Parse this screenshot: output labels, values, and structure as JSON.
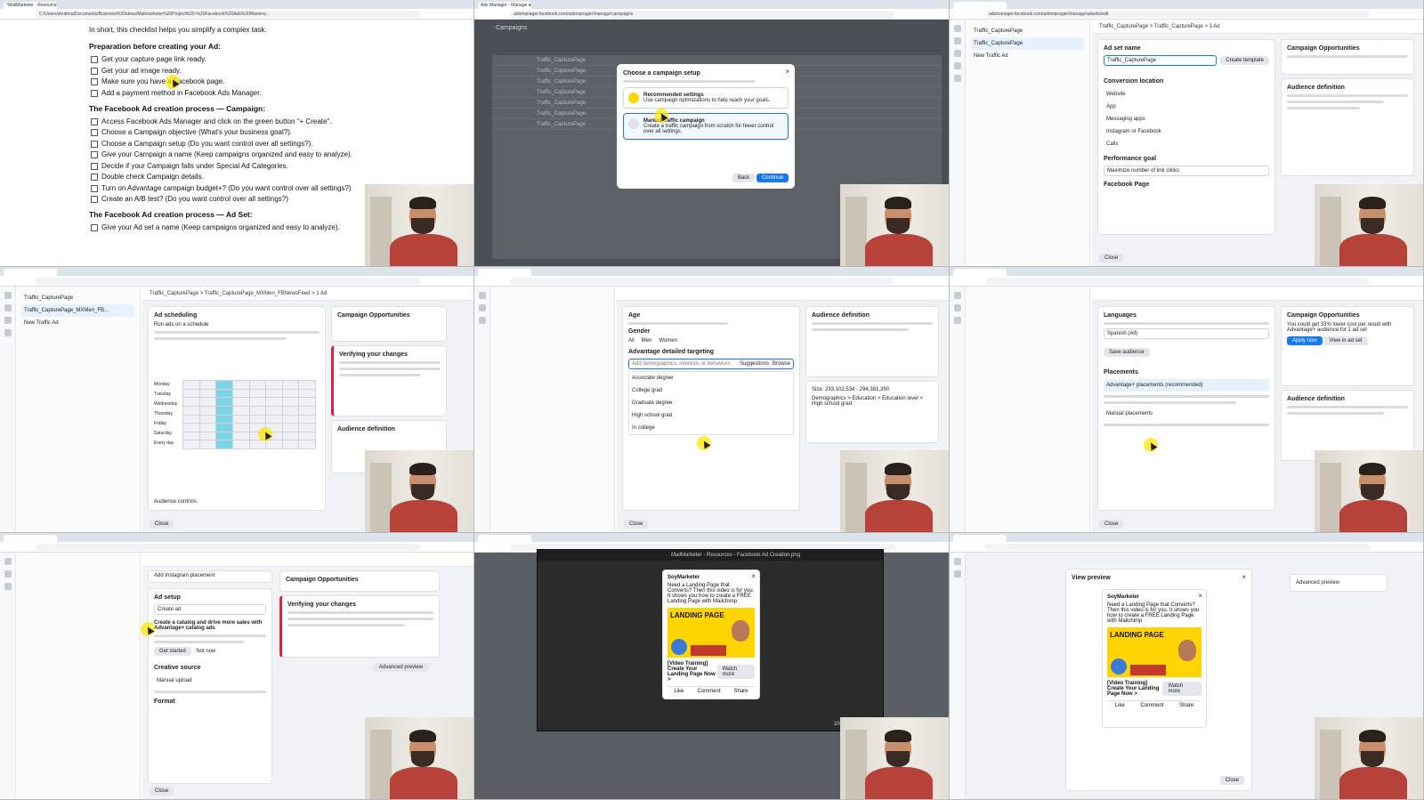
{
  "tile1": {
    "tab": "*MailMarketer - Resources - How To C...",
    "url": "C:/Users/skrahna/Documents/Business%20ideas/Mailmarketer%20Project%20-%20Facebook%20Ads%20Mastery...",
    "intro": "In short, this checklist helps you simplify a complex task.",
    "h1": "Preparation before creating your Ad:",
    "prep": [
      "Get your capture page link ready.",
      "Get your ad image ready.",
      "Make sure you have a Facebook page.",
      "Add a payment method in Facebook Ads Manager."
    ],
    "h2": "The Facebook Ad creation process — Campaign:",
    "campaign": [
      "Access Facebook Ads Manager and click on the green button \"+ Create\".",
      "Choose a Campaign objective (What's your business goal?).",
      "Choose a Campaign setup (Do you want control over all settings?).",
      "Give your Campaign a name (Keep campaigns organized and easy to analyze).",
      "Decide if your Campaign falls under Special Ad Categories.",
      "Double check Campaign details.",
      "Turn on Advantage campaign budget+? (Do you want control over all settings?)",
      "Create an A/B test? (Do you want control over all settings?)"
    ],
    "h3": "The Facebook Ad creation process — Ad Set:",
    "adset": [
      "Give your Ad set a name (Keep campaigns organized and easy to analyze)."
    ]
  },
  "tile2": {
    "tab": "Ads Manager - Manage ads",
    "url": "adsmanager.facebook.com/adsmanager/manage/campaigns",
    "page_title": "Campaigns",
    "rows": [
      "Traffic_CapturePage",
      "Traffic_CapturePage",
      "Traffic_CapturePage",
      "Traffic_CapturePage",
      "Traffic_CapturePage",
      "Traffic_CapturePage",
      "Traffic_CapturePage"
    ],
    "modal_title": "Choose a campaign setup",
    "opt1_title": "Recommended settings",
    "opt1_desc": "Use campaign optimizations to help reach your goals.",
    "opt2_title": "Manual traffic campaign",
    "opt2_desc": "Create a traffic campaign from scratch for fewer control over all settings.",
    "back": "Back",
    "continue": "Continue"
  },
  "tile3": {
    "url": "adsmanager.facebook.com/adsmanager/manage/adsets/edit",
    "breadcrumb": "Traffic_CapturePage  >  Traffic_CapturePage  >  1 Ad",
    "side": [
      "Traffic_CapturePage",
      "Traffic_CapturePage",
      "New Traffic Ad"
    ],
    "adset_name_label": "Ad set name",
    "adset_name_value": "Traffic_CapturePage",
    "create_template": "Create template",
    "conversion_label": "Conversion location",
    "conv_opts": [
      "Website",
      "App",
      "Messaging apps",
      "Instagram or Facebook",
      "Calls"
    ],
    "perf_goal": "Performance goal",
    "perf_value": "Maximize number of link clicks",
    "fb_page": "Facebook Page",
    "opps": "Campaign Opportunities",
    "aud_def": "Audience definition",
    "close": "Close"
  },
  "tile4": {
    "breadcrumb": "Traffic_CapturePage  >  Traffic_CapturePage_MXMen_FBNewsFeed  >  1 Ad",
    "side": [
      "Traffic_CapturePage",
      "Traffic_CapturePage_MXMen_FB...",
      "New Traffic Ad"
    ],
    "sched_title": "Ad scheduling",
    "sched_opt": "Run ads on a schedule",
    "days": [
      "Monday",
      "Tuesday",
      "Wednesday",
      "Thursday",
      "Friday",
      "Saturday",
      "Every day"
    ],
    "verify": "Verifying your changes",
    "opps": "Campaign Opportunities",
    "aud_def": "Audience definition",
    "aud_ctrl": "Audience controls",
    "close": "Close"
  },
  "tile5": {
    "age": "Age",
    "gender": "Gender",
    "gender_opts": [
      "All",
      "Men",
      "Women"
    ],
    "detailed": "Advantage detailed targeting",
    "search_placeholder": "Add demographics, interests or behaviors",
    "suggestions": "Suggestions",
    "browse": "Browse",
    "items": [
      "Associate degree",
      "College grad",
      "Graduate degree",
      "High school grad",
      "In college"
    ],
    "aud_def": "Audience definition",
    "size": "Size: 233,102,534 - 294,381,390",
    "demo": "Demographics > Education > Education level > High school grad",
    "close": "Close"
  },
  "tile6": {
    "languages": "Languages",
    "lang_value": "Spanish (All)",
    "save_aud": "Save audience",
    "placements": "Placements",
    "adv_place": "Advantage+ placements (recommended)",
    "manual_place": "Manual placements",
    "opps": "Campaign Opportunities",
    "opp_text": "You could get 33% lower cost per result with Advantage+ audience for 1 ad set",
    "apply": "Apply now",
    "view": "View in ad set",
    "aud_def": "Audience definition",
    "close": "Close"
  },
  "tile7": {
    "add_ig": "Add Instagram placement",
    "ad_setup": "Ad setup",
    "create_value": "Create ad",
    "catalog": "Create a catalog and drive more sales with Advantage+ catalog ads",
    "get_started": "Get started",
    "not_now": "Not now",
    "creative": "Creative source",
    "manual_upload": "Manual upload",
    "format": "Format",
    "opps": "Campaign Opportunities",
    "verify": "Verifying your changes",
    "adv_preview": "Advanced preview",
    "close": "Close"
  },
  "tile8": {
    "window_title": "MailMarketer - Resources - Facebook Ad Creation.png",
    "page": "SoyMarketer",
    "text": "Need a Landing Page that Converts? Then this video is for you. It shows you how to create a FREE Landing Page with Mailchimp",
    "img_label": "LANDING PAGE",
    "link_title": "[Video Training] Create Your Landing Page Now >",
    "cta": "Watch more",
    "actions": [
      "Like",
      "Comment",
      "Share"
    ],
    "zoom": "100%"
  },
  "tile9": {
    "dialog_title": "View preview",
    "page": "SoyMarketer",
    "text": "Need a Landing Page that Converts? Then this video is for you. It shows you how to create a FREE Landing Page with Mailchimp",
    "img_label": "LANDING PAGE",
    "link_title": "[Video Training] Create Your Landing Page Now >",
    "cta": "Watch more",
    "actions": [
      "Like",
      "Comment",
      "Share"
    ],
    "close": "Close",
    "adv_preview": "Advanced preview"
  }
}
